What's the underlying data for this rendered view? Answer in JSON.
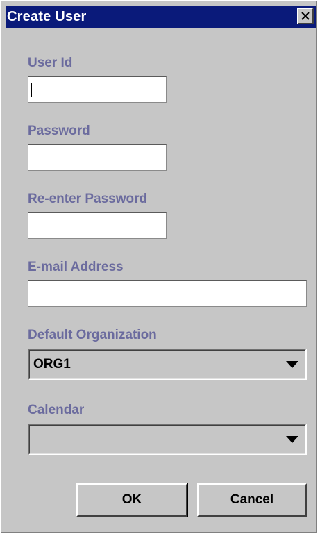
{
  "window": {
    "title": "Create User"
  },
  "form": {
    "user_id": {
      "label": "User Id",
      "value": ""
    },
    "password": {
      "label": "Password",
      "value": ""
    },
    "reenter_password": {
      "label": "Re-enter Password",
      "value": ""
    },
    "email": {
      "label": "E-mail Address",
      "value": ""
    },
    "default_org": {
      "label": "Default Organization",
      "selected": "ORG1"
    },
    "calendar": {
      "label": "Calendar",
      "selected": ""
    }
  },
  "buttons": {
    "ok_label": "OK",
    "cancel_label": "Cancel"
  },
  "colors": {
    "titlebar": "#0a1a7a",
    "label": "#6b6b9e",
    "panel": "#c6c6c6"
  },
  "icons": {
    "close": "close-icon",
    "dropdown": "chevron-down-icon"
  }
}
